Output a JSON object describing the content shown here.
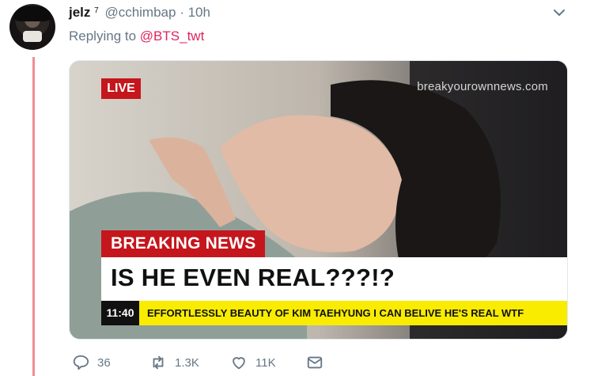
{
  "tweet": {
    "display_name": "jelz",
    "badge": "7",
    "handle": "@cchimbap",
    "separator": "·",
    "time": "10h",
    "reply_prefix": "Replying to",
    "reply_to": "@BTS_twt"
  },
  "media": {
    "watermark": "breakyourownnews.com",
    "live_label": "LIVE",
    "breaking_label": "BREAKING NEWS",
    "headline": "IS HE EVEN REAL???!?",
    "ticker_time": "11:40",
    "ticker_text": "EFFORTLESSLY BEAUTY OF KIM TAEHYUNG I CAN BELIVE HE'S REAL WTF"
  },
  "actions": {
    "replies": "36",
    "retweets": "1.3K",
    "likes": "11K"
  },
  "colors": {
    "accent_mention": "#e0245e",
    "thread_line": "#f08f92",
    "news_red": "#c4161c",
    "ticker_yellow": "#f9ec00",
    "meta_gray": "#657786"
  }
}
